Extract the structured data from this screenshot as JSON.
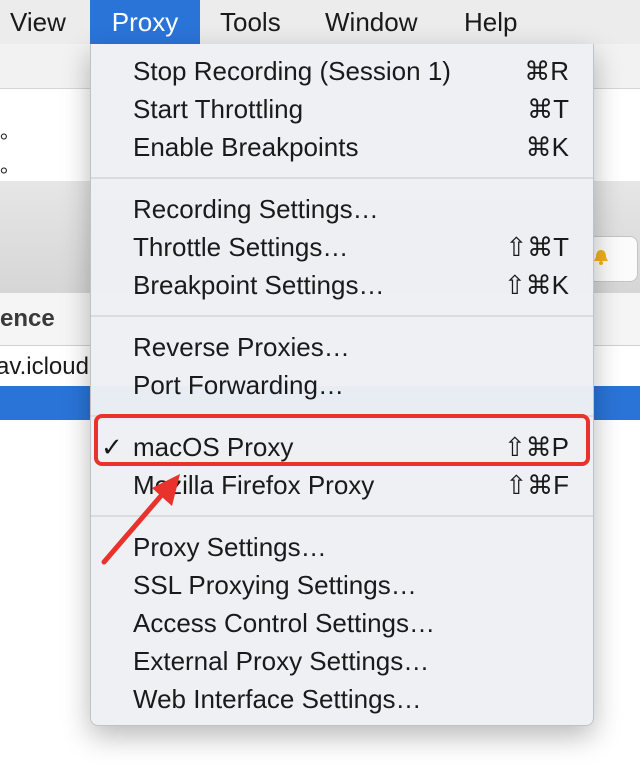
{
  "menubar": {
    "items": [
      {
        "label": "View"
      },
      {
        "label": "Proxy"
      },
      {
        "label": "Tools"
      },
      {
        "label": "Window"
      },
      {
        "label": "Help"
      }
    ]
  },
  "background": {
    "dots": [
      "。",
      "。"
    ],
    "column_header": "ence",
    "row_1": "av.icloud"
  },
  "proxy_menu": {
    "groups": [
      [
        {
          "label": "Stop Recording (Session 1)",
          "shortcut": "⌘R"
        },
        {
          "label": "Start Throttling",
          "shortcut": "⌘T"
        },
        {
          "label": "Enable Breakpoints",
          "shortcut": "⌘K"
        }
      ],
      [
        {
          "label": "Recording Settings…",
          "shortcut": ""
        },
        {
          "label": "Throttle Settings…",
          "shortcut": "⇧⌘T"
        },
        {
          "label": "Breakpoint Settings…",
          "shortcut": "⇧⌘K"
        }
      ],
      [
        {
          "label": "Reverse Proxies…",
          "shortcut": ""
        },
        {
          "label": "Port Forwarding…",
          "shortcut": ""
        }
      ],
      [
        {
          "label": "macOS Proxy",
          "shortcut": "⇧⌘P",
          "checked": true,
          "check": "✓"
        },
        {
          "label": "Mozilla Firefox Proxy",
          "shortcut": "⇧⌘F"
        }
      ],
      [
        {
          "label": "Proxy Settings…",
          "shortcut": ""
        },
        {
          "label": "SSL Proxying Settings…",
          "shortcut": ""
        },
        {
          "label": "Access Control Settings…",
          "shortcut": ""
        },
        {
          "label": "External Proxy Settings…",
          "shortcut": ""
        },
        {
          "label": "Web Interface Settings…",
          "shortcut": ""
        }
      ]
    ]
  },
  "annotation": {
    "highlight_color": "#e8322b"
  },
  "colors": {
    "accent": "#2a74d8"
  }
}
